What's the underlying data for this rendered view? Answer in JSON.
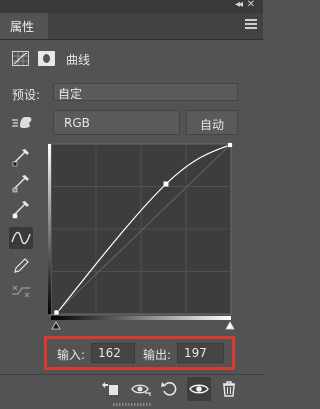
{
  "panel": {
    "tab_label": "属性"
  },
  "adjustment": {
    "title": "曲线"
  },
  "preset": {
    "label": "预设:",
    "value": "自定"
  },
  "channel": {
    "value": "RGB",
    "auto_label": "自动"
  },
  "io": {
    "input_label": "输入:",
    "input_value": "162",
    "output_label": "输出:",
    "output_value": "197"
  },
  "icons": {
    "curves_adjustment": "curves-icon",
    "mask": "mask-icon",
    "on_image_adjust": "hand-icon",
    "black_point": "eyedropper-black-icon",
    "gray_point": "eyedropper-gray-icon",
    "white_point": "eyedropper-white-icon",
    "edit_points": "curve-points-icon",
    "draw_pencil": "pencil-icon",
    "smooth": "smooth-icon",
    "clip_to_layer": "clip-to-layer-icon",
    "view_previous": "view-previous-icon",
    "reset": "reset-icon",
    "visibility": "eye-icon",
    "delete": "trash-icon"
  },
  "colors": {
    "panel_bg": "#535353",
    "highlight_border": "#d9392f"
  }
}
